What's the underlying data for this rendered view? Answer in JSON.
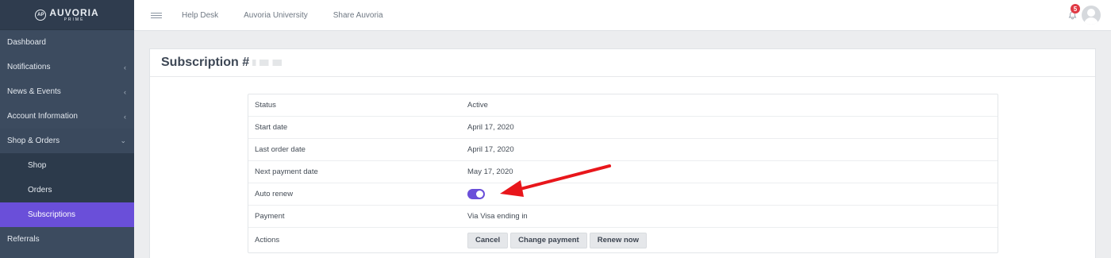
{
  "brand": {
    "name": "AUVORIA",
    "tagline": "PRIME"
  },
  "sidebar": {
    "items": [
      {
        "label": "Dashboard",
        "chevron": ""
      },
      {
        "label": "Notifications",
        "chevron": "‹"
      },
      {
        "label": "News & Events",
        "chevron": "‹"
      },
      {
        "label": "Account Information",
        "chevron": "‹"
      },
      {
        "label": "Shop & Orders",
        "chevron": "⌄"
      }
    ],
    "subitems": [
      {
        "label": "Shop"
      },
      {
        "label": "Orders"
      },
      {
        "label": "Subscriptions"
      }
    ],
    "after": [
      {
        "label": "Referrals"
      }
    ]
  },
  "topbar": {
    "links": [
      "Help Desk",
      "Auvoria University",
      "Share Auvoria"
    ],
    "notification_count": "5"
  },
  "page": {
    "title": "Subscription #"
  },
  "details": {
    "status_label": "Status",
    "status_value": "Active",
    "start_label": "Start date",
    "start_value": "April 17, 2020",
    "last_order_label": "Last order date",
    "last_order_value": "April 17, 2020",
    "next_payment_label": "Next payment date",
    "next_payment_value": "May 17, 2020",
    "auto_renew_label": "Auto renew",
    "payment_label": "Payment",
    "payment_value": "Via Visa ending in",
    "actions_label": "Actions"
  },
  "actions": {
    "cancel": "Cancel",
    "change_payment": "Change payment",
    "renew_now": "Renew now"
  },
  "colors": {
    "accent": "#6a4fd9",
    "sidebar": "#3c4b5f",
    "badge": "#e03a45",
    "annotation_arrow": "#e8161b"
  }
}
